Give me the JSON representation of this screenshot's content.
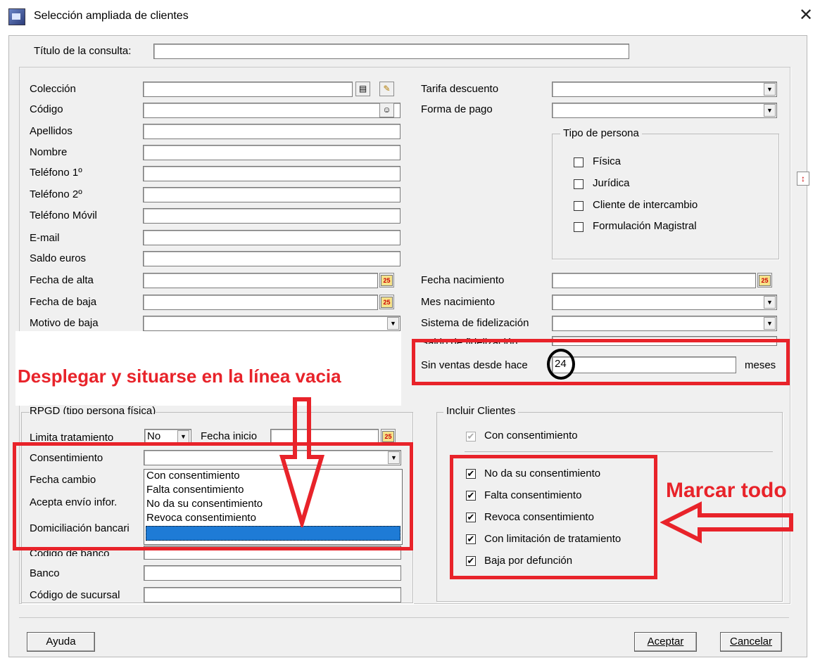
{
  "window": {
    "title": "Selección ampliada de clientes",
    "close_glyph": "✕"
  },
  "query_title": {
    "label": "Título de la consulta:",
    "value": ""
  },
  "left_fields": [
    {
      "label": "Colección"
    },
    {
      "label": "Código"
    },
    {
      "label": "Apellidos"
    },
    {
      "label": "Nombre"
    },
    {
      "label": "Teléfono 1º"
    },
    {
      "label": "Teléfono 2º"
    },
    {
      "label": "Teléfono Móvil"
    },
    {
      "label": "E-mail"
    },
    {
      "label": "Saldo euros"
    },
    {
      "label": "Fecha de alta"
    },
    {
      "label": "Fecha de baja"
    },
    {
      "label": "Motivo de baja"
    }
  ],
  "right_fields": [
    {
      "label": "Tarifa descuento"
    },
    {
      "label": "Forma de pago"
    },
    {
      "label": "Fecha nacimiento"
    },
    {
      "label": "Mes nacimiento"
    },
    {
      "label": "Sistema de fidelización"
    },
    {
      "label": "Saldo de fidelización"
    }
  ],
  "no_sales": {
    "label": "Sin ventas desde hace",
    "value": "24",
    "unit": "meses"
  },
  "person_type": {
    "title": "Tipo de persona",
    "options": [
      {
        "label": "Física",
        "checked": false
      },
      {
        "label": "Jurídica",
        "checked": false
      },
      {
        "label": "Cliente de intercambio",
        "checked": false
      },
      {
        "label": "Formulación Magistral",
        "checked": false
      }
    ]
  },
  "rgpd": {
    "title": "RPGD (tipo persona física)",
    "limita_label": "Limita tratamiento",
    "limita_value": "No",
    "fecha_inicio_label": "Fecha inicio",
    "consentimiento_label": "Consentimiento",
    "fecha_cambio_label": "Fecha cambio",
    "acepta_label": "Acepta envío infor.",
    "domiciliacion_label": "Domiciliación bancari",
    "codigo_banco_label": "Código de banco",
    "banco_label": "Banco",
    "sucursal_label": "Código de sucursal"
  },
  "dropdown": {
    "items": [
      "Con consentimiento",
      "Falta consentimiento",
      "No da su consentimiento",
      "Revoca consentimiento",
      ""
    ],
    "selected_index": 4
  },
  "include_clients": {
    "title": "Incluir Clientes",
    "con_consentimiento": {
      "label": "Con consentimiento",
      "checked": true,
      "disabled": true
    },
    "options": [
      {
        "label": "No da su consentimiento",
        "checked": true
      },
      {
        "label": "Falta consentimiento",
        "checked": true
      },
      {
        "label": "Revoca consentimiento",
        "checked": true
      },
      {
        "label": "Con limitación de tratamiento",
        "checked": true
      },
      {
        "label": "Baja por defunción",
        "checked": true
      }
    ]
  },
  "annotations": {
    "dropdown_note": "Desplegar y situarse en la línea vacia",
    "check_note": "Marcar todo",
    "color": "#e8232a"
  },
  "buttons": {
    "help": "Ayuda",
    "accept": "Aceptar",
    "cancel": "Cancelar"
  },
  "icons": {
    "cal_text": "25",
    "check_glyph": "✔",
    "combo_glyph": "▼"
  }
}
